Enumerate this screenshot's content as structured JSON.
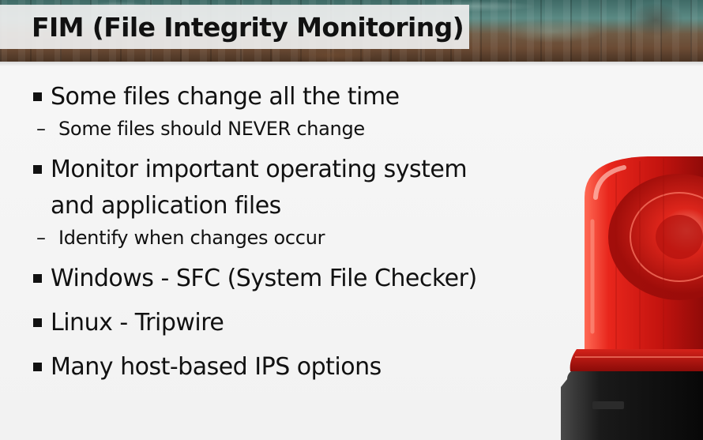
{
  "slide": {
    "title": "FIM (File Integrity Monitoring)",
    "bullets": [
      {
        "text": "Some files change all the time",
        "sub": [
          {
            "dash": "–",
            "text": "Some files should NEVER change"
          }
        ]
      },
      {
        "text_line1": "Monitor important operating system",
        "text_line2": "and application files",
        "sub": [
          {
            "dash": "–",
            "text": "Identify when changes occur"
          }
        ]
      },
      {
        "text": "Windows - SFC (System File Checker)"
      },
      {
        "text": "Linux - Tripwire"
      },
      {
        "text": "Many host-based IPS options"
      }
    ]
  },
  "colors": {
    "beacon_red": "#e0201a",
    "beacon_base": "#1c1c1c",
    "header_wood": "#5b8a84"
  },
  "icons": {
    "bullet": "square-bullet-icon",
    "illustration": "alarm-beacon-icon"
  }
}
